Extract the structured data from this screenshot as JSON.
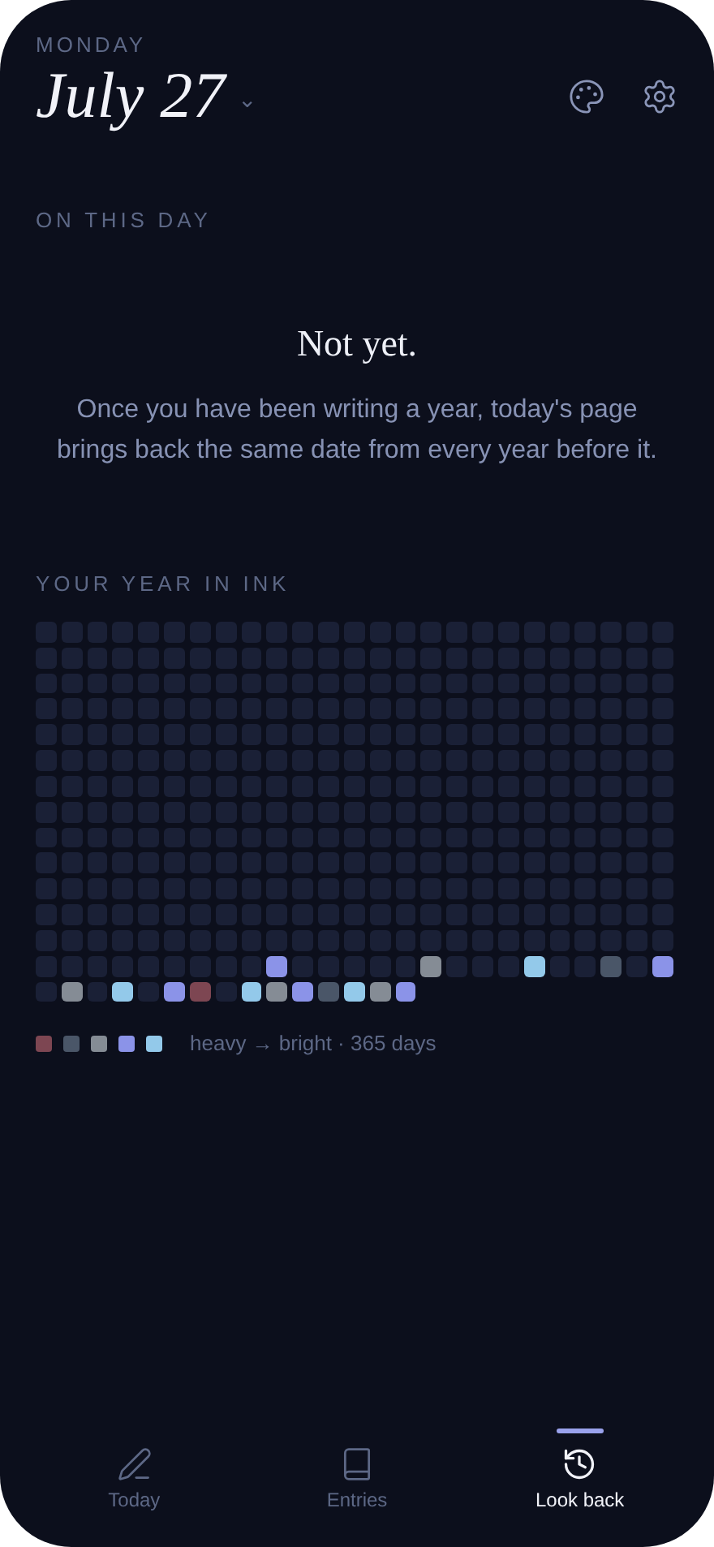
{
  "header": {
    "weekday": "MONDAY",
    "date": "July 27",
    "date_caret": "⌄"
  },
  "on_this_day": {
    "heading": "ON THIS DAY",
    "title": "Not yet.",
    "message": "Once you have been writing a year, today's page brings back the same date from every year before it."
  },
  "year_grid": {
    "heading": "YOUR YEAR IN INK",
    "rows": [
      [
        {
          "color": "#1a2036"
        },
        {
          "color": "#1a2036"
        },
        {
          "color": "#1a2036"
        },
        {
          "color": "#1a2036"
        },
        {
          "color": "#1a2036"
        },
        {
          "color": "#1a2036"
        },
        {
          "color": "#1a2036"
        },
        {
          "color": "#1a2036"
        },
        {
          "color": "#1a2036"
        },
        {
          "color": "#1a2036"
        },
        {
          "color": "#1a2036"
        },
        {
          "color": "#1a2036"
        },
        {
          "color": "#1a2036"
        },
        {
          "color": "#1a2036"
        },
        {
          "color": "#1a2036"
        },
        {
          "color": "#1a2036"
        },
        {
          "color": "#1a2036"
        },
        {
          "color": "#1a2036"
        },
        {
          "color": "#1a2036"
        },
        {
          "color": "#1a2036"
        },
        {
          "color": "#1a2036"
        },
        {
          "color": "#1a2036"
        },
        {
          "color": "#1a2036"
        },
        {
          "color": "#1a2036"
        },
        {
          "color": "#1a2036"
        }
      ],
      [
        {
          "color": "#1a2036"
        },
        {
          "color": "#1a2036"
        },
        {
          "color": "#1a2036"
        },
        {
          "color": "#1a2036"
        },
        {
          "color": "#1a2036"
        },
        {
          "color": "#1a2036"
        },
        {
          "color": "#1a2036"
        },
        {
          "color": "#1a2036"
        },
        {
          "color": "#1a2036"
        },
        {
          "color": "#1a2036"
        },
        {
          "color": "#1a2036"
        },
        {
          "color": "#1a2036"
        },
        {
          "color": "#1a2036"
        },
        {
          "color": "#1a2036"
        },
        {
          "color": "#1a2036"
        },
        {
          "color": "#1a2036"
        },
        {
          "color": "#1a2036"
        },
        {
          "color": "#1a2036"
        },
        {
          "color": "#1a2036"
        },
        {
          "color": "#1a2036"
        },
        {
          "color": "#1a2036"
        },
        {
          "color": "#1a2036"
        },
        {
          "color": "#1a2036"
        },
        {
          "color": "#1a2036"
        },
        {
          "color": "#1a2036"
        }
      ],
      [
        {
          "color": "#1a2036"
        },
        {
          "color": "#1a2036"
        },
        {
          "color": "#1a2036"
        },
        {
          "color": "#1a2036"
        },
        {
          "color": "#1a2036"
        },
        {
          "color": "#1a2036"
        },
        {
          "color": "#1a2036"
        },
        {
          "color": "#1a2036"
        },
        {
          "color": "#1a2036"
        },
        {
          "color": "#1a2036"
        },
        {
          "color": "#1a2036"
        },
        {
          "color": "#1a2036"
        },
        {
          "color": "#1a2036"
        },
        {
          "color": "#1a2036"
        },
        {
          "color": "#1a2036"
        },
        {
          "color": "#1a2036"
        },
        {
          "color": "#1a2036"
        },
        {
          "color": "#1a2036"
        },
        {
          "color": "#1a2036"
        },
        {
          "color": "#1a2036"
        },
        {
          "color": "#1a2036"
        },
        {
          "color": "#1a2036"
        },
        {
          "color": "#1a2036"
        },
        {
          "color": "#1a2036"
        },
        {
          "color": "#1a2036"
        }
      ],
      [
        {
          "color": "#1a2036"
        },
        {
          "color": "#1a2036"
        },
        {
          "color": "#1a2036"
        },
        {
          "color": "#1a2036"
        },
        {
          "color": "#1a2036"
        },
        {
          "color": "#1a2036"
        },
        {
          "color": "#1a2036"
        },
        {
          "color": "#1a2036"
        },
        {
          "color": "#1a2036"
        },
        {
          "color": "#1a2036"
        },
        {
          "color": "#1a2036"
        },
        {
          "color": "#1a2036"
        },
        {
          "color": "#1a2036"
        },
        {
          "color": "#1a2036"
        },
        {
          "color": "#1a2036"
        },
        {
          "color": "#1a2036"
        },
        {
          "color": "#1a2036"
        },
        {
          "color": "#1a2036"
        },
        {
          "color": "#1a2036"
        },
        {
          "color": "#1a2036"
        },
        {
          "color": "#1a2036"
        },
        {
          "color": "#1a2036"
        },
        {
          "color": "#1a2036"
        },
        {
          "color": "#1a2036"
        },
        {
          "color": "#1a2036"
        }
      ],
      [
        {
          "color": "#1a2036"
        },
        {
          "color": "#1a2036"
        },
        {
          "color": "#1a2036"
        },
        {
          "color": "#1a2036"
        },
        {
          "color": "#1a2036"
        },
        {
          "color": "#1a2036"
        },
        {
          "color": "#1a2036"
        },
        {
          "color": "#1a2036"
        },
        {
          "color": "#1a2036"
        },
        {
          "color": "#1a2036"
        },
        {
          "color": "#1a2036"
        },
        {
          "color": "#1a2036"
        },
        {
          "color": "#1a2036"
        },
        {
          "color": "#1a2036"
        },
        {
          "color": "#1a2036"
        },
        {
          "color": "#1a2036"
        },
        {
          "color": "#1a2036"
        },
        {
          "color": "#1a2036"
        },
        {
          "color": "#1a2036"
        },
        {
          "color": "#1a2036"
        },
        {
          "color": "#1a2036"
        },
        {
          "color": "#1a2036"
        },
        {
          "color": "#1a2036"
        },
        {
          "color": "#1a2036"
        },
        {
          "color": "#1a2036"
        }
      ],
      [
        {
          "color": "#1a2036"
        },
        {
          "color": "#1a2036"
        },
        {
          "color": "#1a2036"
        },
        {
          "color": "#1a2036"
        },
        {
          "color": "#1a2036"
        },
        {
          "color": "#1a2036"
        },
        {
          "color": "#1a2036"
        },
        {
          "color": "#1a2036"
        },
        {
          "color": "#1a2036"
        },
        {
          "color": "#1a2036"
        },
        {
          "color": "#1a2036"
        },
        {
          "color": "#1a2036"
        },
        {
          "color": "#1a2036"
        },
        {
          "color": "#1a2036"
        },
        {
          "color": "#1a2036"
        },
        {
          "color": "#1a2036"
        },
        {
          "color": "#1a2036"
        },
        {
          "color": "#1a2036"
        },
        {
          "color": "#1a2036"
        },
        {
          "color": "#1a2036"
        },
        {
          "color": "#1a2036"
        },
        {
          "color": "#1a2036"
        },
        {
          "color": "#1a2036"
        },
        {
          "color": "#1a2036"
        },
        {
          "color": "#1a2036"
        }
      ],
      [
        {
          "color": "#1a2036"
        },
        {
          "color": "#1a2036"
        },
        {
          "color": "#1a2036"
        },
        {
          "color": "#1a2036"
        },
        {
          "color": "#1a2036"
        },
        {
          "color": "#1a2036"
        },
        {
          "color": "#1a2036"
        },
        {
          "color": "#1a2036"
        },
        {
          "color": "#1a2036"
        },
        {
          "color": "#1a2036"
        },
        {
          "color": "#1a2036"
        },
        {
          "color": "#1a2036"
        },
        {
          "color": "#1a2036"
        },
        {
          "color": "#1a2036"
        },
        {
          "color": "#1a2036"
        },
        {
          "color": "#1a2036"
        },
        {
          "color": "#1a2036"
        },
        {
          "color": "#1a2036"
        },
        {
          "color": "#1a2036"
        },
        {
          "color": "#1a2036"
        },
        {
          "color": "#1a2036"
        },
        {
          "color": "#1a2036"
        },
        {
          "color": "#1a2036"
        },
        {
          "color": "#1a2036"
        },
        {
          "color": "#1a2036"
        }
      ],
      [
        {
          "color": "#1a2036"
        },
        {
          "color": "#1a2036"
        },
        {
          "color": "#1a2036"
        },
        {
          "color": "#1a2036"
        },
        {
          "color": "#1a2036"
        },
        {
          "color": "#1a2036"
        },
        {
          "color": "#1a2036"
        },
        {
          "color": "#1a2036"
        },
        {
          "color": "#1a2036"
        },
        {
          "color": "#1a2036"
        },
        {
          "color": "#1a2036"
        },
        {
          "color": "#1a2036"
        },
        {
          "color": "#1a2036"
        },
        {
          "color": "#1a2036"
        },
        {
          "color": "#1a2036"
        },
        {
          "color": "#1a2036"
        },
        {
          "color": "#1a2036"
        },
        {
          "color": "#1a2036"
        },
        {
          "color": "#1a2036"
        },
        {
          "color": "#1a2036"
        },
        {
          "color": "#1a2036"
        },
        {
          "color": "#1a2036"
        },
        {
          "color": "#1a2036"
        },
        {
          "color": "#1a2036"
        },
        {
          "color": "#1a2036"
        }
      ],
      [
        {
          "color": "#1a2036"
        },
        {
          "color": "#1a2036"
        },
        {
          "color": "#1a2036"
        },
        {
          "color": "#1a2036"
        },
        {
          "color": "#1a2036"
        },
        {
          "color": "#1a2036"
        },
        {
          "color": "#1a2036"
        },
        {
          "color": "#1a2036"
        },
        {
          "color": "#1a2036"
        },
        {
          "color": "#1a2036"
        },
        {
          "color": "#1a2036"
        },
        {
          "color": "#1a2036"
        },
        {
          "color": "#1a2036"
        },
        {
          "color": "#1a2036"
        },
        {
          "color": "#1a2036"
        },
        {
          "color": "#1a2036"
        },
        {
          "color": "#1a2036"
        },
        {
          "color": "#1a2036"
        },
        {
          "color": "#1a2036"
        },
        {
          "color": "#1a2036"
        },
        {
          "color": "#1a2036"
        },
        {
          "color": "#1a2036"
        },
        {
          "color": "#1a2036"
        },
        {
          "color": "#1a2036"
        },
        {
          "color": "#1a2036"
        }
      ],
      [
        {
          "color": "#1a2036"
        },
        {
          "color": "#1a2036"
        },
        {
          "color": "#1a2036"
        },
        {
          "color": "#1a2036"
        },
        {
          "color": "#1a2036"
        },
        {
          "color": "#1a2036"
        },
        {
          "color": "#1a2036"
        },
        {
          "color": "#1a2036"
        },
        {
          "color": "#1a2036"
        },
        {
          "color": "#1a2036"
        },
        {
          "color": "#1a2036"
        },
        {
          "color": "#1a2036"
        },
        {
          "color": "#1a2036"
        },
        {
          "color": "#1a2036"
        },
        {
          "color": "#1a2036"
        },
        {
          "color": "#1a2036"
        },
        {
          "color": "#1a2036"
        },
        {
          "color": "#1a2036"
        },
        {
          "color": "#1a2036"
        },
        {
          "color": "#1a2036"
        },
        {
          "color": "#1a2036"
        },
        {
          "color": "#1a2036"
        },
        {
          "color": "#1a2036"
        },
        {
          "color": "#1a2036"
        },
        {
          "color": "#1a2036"
        }
      ],
      [
        {
          "color": "#1a2036"
        },
        {
          "color": "#1a2036"
        },
        {
          "color": "#1a2036"
        },
        {
          "color": "#1a2036"
        },
        {
          "color": "#1a2036"
        },
        {
          "color": "#1a2036"
        },
        {
          "color": "#1a2036"
        },
        {
          "color": "#1a2036"
        },
        {
          "color": "#1a2036"
        },
        {
          "color": "#1a2036"
        },
        {
          "color": "#1a2036"
        },
        {
          "color": "#1a2036"
        },
        {
          "color": "#1a2036"
        },
        {
          "color": "#1a2036"
        },
        {
          "color": "#1a2036"
        },
        {
          "color": "#1a2036"
        },
        {
          "color": "#1a2036"
        },
        {
          "color": "#1a2036"
        },
        {
          "color": "#1a2036"
        },
        {
          "color": "#1a2036"
        },
        {
          "color": "#1a2036"
        },
        {
          "color": "#1a2036"
        },
        {
          "color": "#1a2036"
        },
        {
          "color": "#1a2036"
        },
        {
          "color": "#1a2036"
        }
      ],
      [
        {
          "color": "#1a2036"
        },
        {
          "color": "#1a2036"
        },
        {
          "color": "#1a2036"
        },
        {
          "color": "#1a2036"
        },
        {
          "color": "#1a2036"
        },
        {
          "color": "#1a2036"
        },
        {
          "color": "#1a2036"
        },
        {
          "color": "#1a2036"
        },
        {
          "color": "#1a2036"
        },
        {
          "color": "#1a2036"
        },
        {
          "color": "#1a2036"
        },
        {
          "color": "#1a2036"
        },
        {
          "color": "#1a2036"
        },
        {
          "color": "#1a2036"
        },
        {
          "color": "#1a2036"
        },
        {
          "color": "#1a2036"
        },
        {
          "color": "#1a2036"
        },
        {
          "color": "#1a2036"
        },
        {
          "color": "#1a2036"
        },
        {
          "color": "#1a2036"
        },
        {
          "color": "#1a2036"
        },
        {
          "color": "#1a2036"
        },
        {
          "color": "#1a2036"
        },
        {
          "color": "#1a2036"
        },
        {
          "color": "#1a2036"
        }
      ],
      [
        {
          "color": "#1a2036"
        },
        {
          "color": "#1a2036"
        },
        {
          "color": "#1a2036"
        },
        {
          "color": "#1a2036"
        },
        {
          "color": "#1a2036"
        },
        {
          "color": "#1a2036"
        },
        {
          "color": "#1a2036"
        },
        {
          "color": "#1a2036"
        },
        {
          "color": "#1a2036"
        },
        {
          "color": "#1a2036"
        },
        {
          "color": "#1a2036"
        },
        {
          "color": "#1a2036"
        },
        {
          "color": "#1a2036"
        },
        {
          "color": "#1a2036"
        },
        {
          "color": "#1a2036"
        },
        {
          "color": "#1a2036"
        },
        {
          "color": "#1a2036"
        },
        {
          "color": "#1a2036"
        },
        {
          "color": "#1a2036"
        },
        {
          "color": "#1a2036"
        },
        {
          "color": "#1a2036"
        },
        {
          "color": "#1a2036"
        },
        {
          "color": "#1a2036"
        },
        {
          "color": "#1a2036"
        },
        {
          "color": "#1a2036"
        }
      ],
      [
        {
          "color": "#1a2036"
        },
        {
          "color": "#1a2036"
        },
        {
          "color": "#1a2036"
        },
        {
          "color": "#1a2036"
        },
        {
          "color": "#1a2036"
        },
        {
          "color": "#1a2036"
        },
        {
          "color": "#1a2036"
        },
        {
          "color": "#1a2036"
        },
        {
          "color": "#1a2036"
        },
        {
          "color": "#8b93e8"
        },
        {
          "color": "#1a2036"
        },
        {
          "color": "#1a2036"
        },
        {
          "color": "#1a2036"
        },
        {
          "color": "#1a2036"
        },
        {
          "color": "#1a2036"
        },
        {
          "color": "#858c95"
        },
        {
          "color": "#1a2036"
        },
        {
          "color": "#1a2036"
        },
        {
          "color": "#1a2036"
        },
        {
          "color": "#93c9ea"
        },
        {
          "color": "#1a2036"
        },
        {
          "color": "#1a2036"
        },
        {
          "color": "#4a5668"
        },
        {
          "color": "#1a2036"
        },
        {
          "color": "#8b93e8"
        }
      ],
      [
        {
          "color": "#1a2036"
        },
        {
          "color": "#858c95"
        },
        {
          "color": "#1a2036"
        },
        {
          "color": "#93c9ea"
        },
        {
          "color": "#1a2036"
        },
        {
          "color": "#8b93e8"
        },
        {
          "color": "#7d4652"
        },
        {
          "color": "#1a2036"
        },
        {
          "color": "#93c9ea"
        },
        {
          "color": "#858c95"
        },
        {
          "color": "#8b93e8"
        },
        {
          "color": "#4a5668"
        },
        {
          "color": "#93c9ea"
        },
        {
          "color": "#858c95"
        },
        {
          "color": "#8b93e8"
        }
      ]
    ],
    "legend": [
      {
        "color": "#7d4652"
      },
      {
        "color": "#4a5668"
      },
      {
        "color": "#858c95"
      },
      {
        "color": "#8b93e8"
      },
      {
        "color": "#93c9ea"
      }
    ],
    "legend_text": "heavy → bright · 365 days"
  },
  "nav": [
    {
      "kind": "pen",
      "label": "Today",
      "selected": false
    },
    {
      "kind": "book",
      "label": "Entries",
      "selected": false
    },
    {
      "kind": "history",
      "label": "Look back",
      "selected": true
    }
  ]
}
